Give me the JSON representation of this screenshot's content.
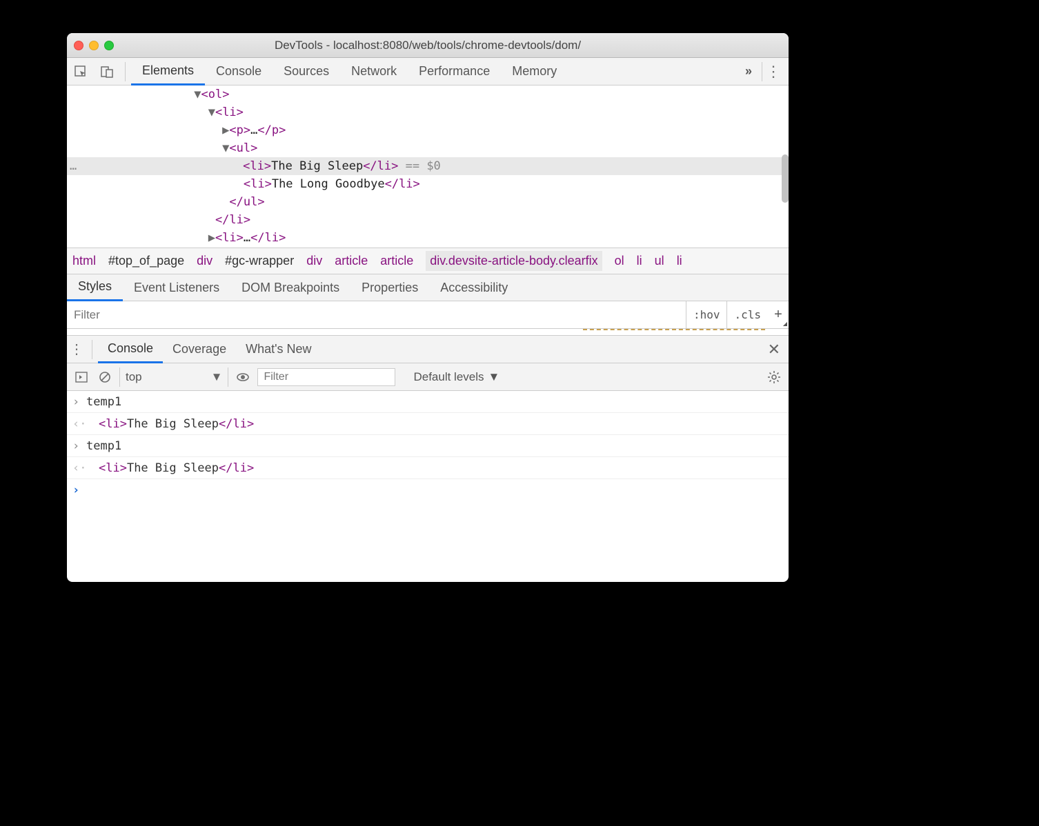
{
  "window": {
    "title": "DevTools - localhost:8080/web/tools/chrome-devtools/dom/"
  },
  "main_tabs": {
    "items": [
      "Elements",
      "Console",
      "Sources",
      "Network",
      "Performance",
      "Memory"
    ],
    "active": "Elements",
    "overflow_glyph": "»"
  },
  "dom_tree": {
    "lines": [
      {
        "indent": 9,
        "tri": "▼",
        "open": "<ol>",
        "text": "",
        "close": "",
        "selected": false
      },
      {
        "indent": 10,
        "tri": "▼",
        "open": "<li>",
        "text": "",
        "close": "",
        "selected": false
      },
      {
        "indent": 11,
        "tri": "▶",
        "open": "<p>",
        "text": "…",
        "close": "</p>",
        "selected": false
      },
      {
        "indent": 11,
        "tri": "▼",
        "open": "<ul>",
        "text": "",
        "close": "",
        "selected": false
      },
      {
        "indent": 12,
        "tri": "",
        "open": "<li>",
        "text": "The Big Sleep",
        "close": "</li>",
        "suffixFaded": " == $0",
        "selected": true
      },
      {
        "indent": 12,
        "tri": "",
        "open": "<li>",
        "text": "The Long Goodbye",
        "close": "</li>",
        "selected": false
      },
      {
        "indent": 11,
        "tri": "",
        "open": "",
        "text": "",
        "close": "</ul>",
        "selected": false
      },
      {
        "indent": 10,
        "tri": "",
        "open": "",
        "text": "",
        "close": "</li>",
        "selected": false
      },
      {
        "indent": 10,
        "tri": "▶",
        "open": "<li>",
        "text": "…",
        "close": "</li>",
        "selected": false
      }
    ],
    "selected_dots": "…"
  },
  "breadcrumb": {
    "items": [
      {
        "t": "html",
        "cls": "bc"
      },
      {
        "t": "#top_of_page",
        "cls": "bc id"
      },
      {
        "t": "div",
        "cls": "bc"
      },
      {
        "t": "#gc-wrapper",
        "cls": "bc id"
      },
      {
        "t": "div",
        "cls": "bc"
      },
      {
        "t": "article",
        "cls": "bc"
      },
      {
        "t": "article",
        "cls": "bc"
      },
      {
        "t": "div.devsite-article-body.clearfix",
        "cls": "bc sel"
      },
      {
        "t": "ol",
        "cls": "bc"
      },
      {
        "t": "li",
        "cls": "bc"
      },
      {
        "t": "ul",
        "cls": "bc"
      },
      {
        "t": "li",
        "cls": "bc"
      }
    ]
  },
  "styles_tabs": {
    "items": [
      "Styles",
      "Event Listeners",
      "DOM Breakpoints",
      "Properties",
      "Accessibility"
    ],
    "active": "Styles"
  },
  "filter_bar": {
    "placeholder": "Filter",
    "hov": ":hov",
    "cls": ".cls"
  },
  "drawer_tabs": {
    "items": [
      "Console",
      "Coverage",
      "What's New"
    ],
    "active": "Console"
  },
  "console_toolbar": {
    "context": "top",
    "filter_placeholder": "Filter",
    "levels": "Default levels"
  },
  "console_rows": [
    {
      "kind": "in",
      "text": "temp1"
    },
    {
      "kind": "out",
      "tagOpen": "<li>",
      "text": "The Big Sleep",
      "tagClose": "</li>"
    },
    {
      "kind": "in",
      "text": "temp1"
    },
    {
      "kind": "out",
      "tagOpen": "<li>",
      "text": "The Big Sleep",
      "tagClose": "</li>"
    }
  ]
}
